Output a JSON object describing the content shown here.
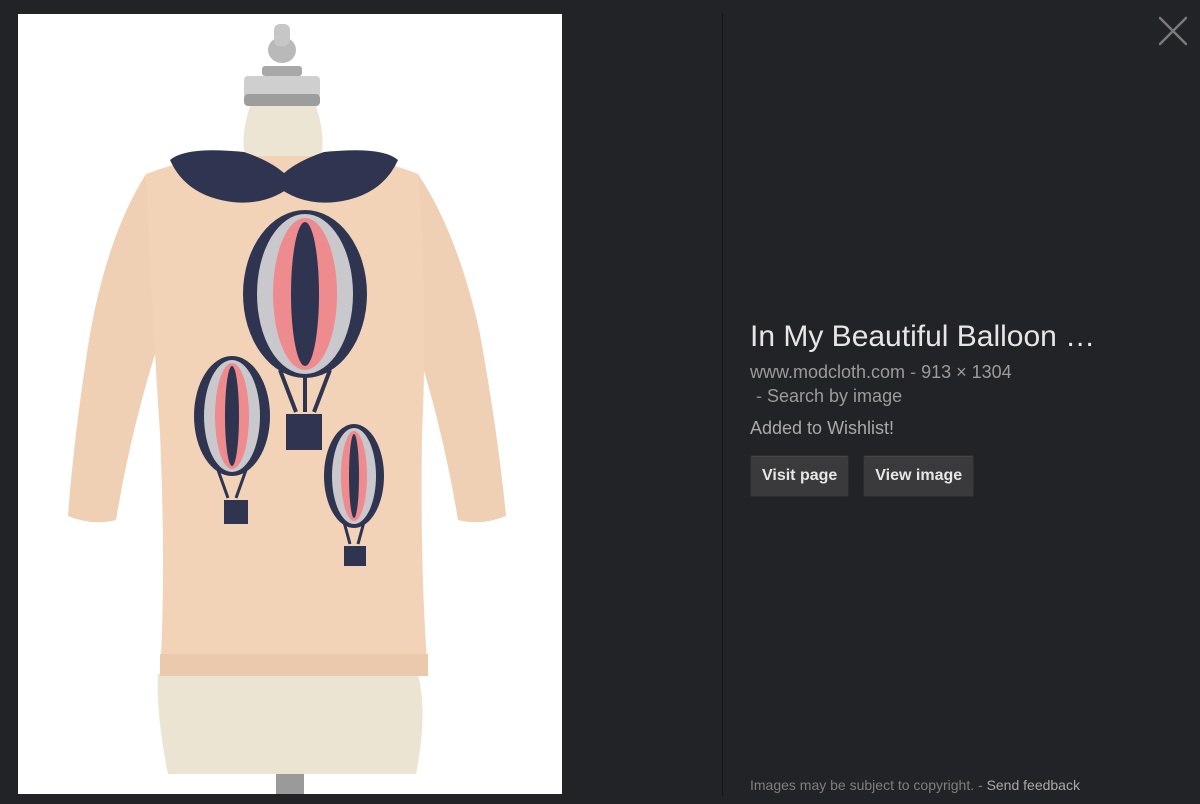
{
  "viewer": {
    "title": "In My Beautiful Balloon …",
    "source_site": "www.modcloth.com",
    "separator": "-",
    "dimensions": "913 × 1304",
    "search_by_image": "Search by image",
    "status": "Added to Wishlist!",
    "visit_page_label": "Visit page",
    "view_image_label": "View image",
    "copyright_notice": "Images may be subject to copyright.",
    "send_feedback_label": "Send feedback"
  },
  "icons": {
    "close": "close-icon"
  },
  "colors": {
    "background": "#222326",
    "title_text": "#e6e6e6",
    "meta_text": "#9b9b9b",
    "button_bg": "#3a3a3c",
    "sweater": "#f1d2b7",
    "collar": "#2f3550",
    "balloon_pink": "#ee8b8f",
    "balloon_gray": "#c9c9cd"
  }
}
